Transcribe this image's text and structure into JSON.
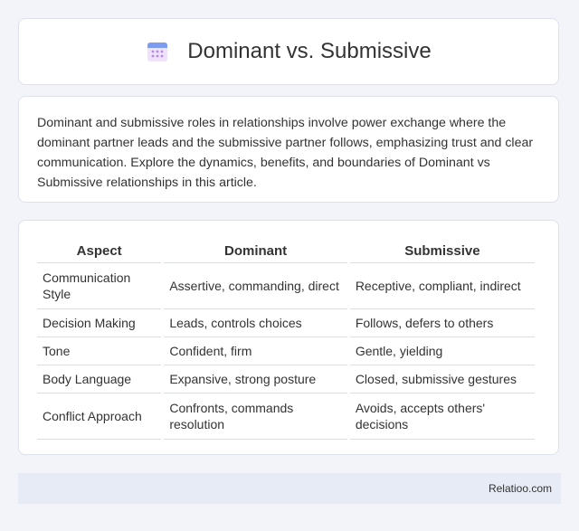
{
  "header": {
    "icon": "calendar-icon",
    "title": "Dominant vs. Submissive"
  },
  "intro": {
    "text": "Dominant and submissive roles in relationships involve power exchange where the dominant partner leads and the submissive partner follows, emphasizing trust and clear communication. Explore the dynamics, benefits, and boundaries of Dominant vs Submissive relationships in this article."
  },
  "table": {
    "headers": [
      "Aspect",
      "Dominant",
      "Submissive"
    ],
    "rows": [
      [
        "Communication Style",
        "Assertive, commanding, direct",
        "Receptive, compliant, indirect"
      ],
      [
        "Decision Making",
        "Leads, controls choices",
        "Follows, defers to others"
      ],
      [
        "Tone",
        "Confident, firm",
        "Gentle, yielding"
      ],
      [
        "Body Language",
        "Expansive, strong posture",
        "Closed, submissive gestures"
      ],
      [
        "Conflict Approach",
        "Confronts, commands resolution",
        "Avoids, accepts others' decisions"
      ]
    ]
  },
  "footer": {
    "text": "Relatioo.com"
  },
  "colors": {
    "background": "#f2f4f9",
    "card": "#ffffff",
    "footer": "#e7ebf5",
    "icon_top": "#7b9cf0",
    "icon_body": "#e9d5f7",
    "icon_dots": "#b48ae6"
  }
}
